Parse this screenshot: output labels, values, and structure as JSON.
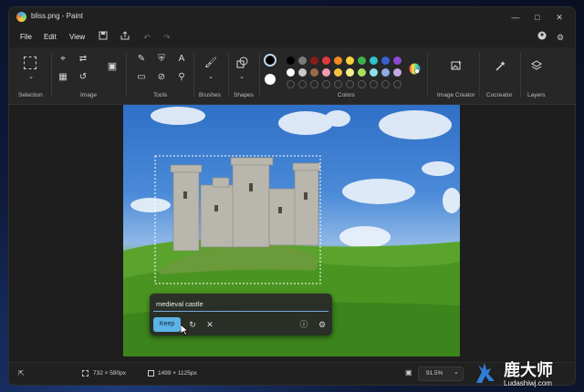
{
  "window": {
    "title": "bliss.png - Paint"
  },
  "menu": {
    "file": "File",
    "edit": "Edit",
    "view": "View"
  },
  "ribbon": {
    "groups": {
      "selection": "Selection",
      "image": "Image",
      "tools": "Tools",
      "brushes": "Brushes",
      "shapes": "Shapes",
      "colors": "Colors",
      "image_creator": "Image Creator",
      "cocreator": "Cocreator",
      "layers": "Layers"
    },
    "palette_row1": [
      "#000000",
      "#7a7a7a",
      "#8a1c1c",
      "#e0393e",
      "#f08a24",
      "#f6d33c",
      "#3bb34a",
      "#2ec4c9",
      "#3a5fd1",
      "#8a4bd1"
    ],
    "palette_row2": [
      "#ffffff",
      "#c8c8c8",
      "#9a6a4a",
      "#f29ab0",
      "#f6c240",
      "#f3ef8a",
      "#a6e05a",
      "#8fe0e6",
      "#8fa9e6",
      "#c4a8e6"
    ],
    "primary_color": "#000000",
    "secondary_color": "#ffffff"
  },
  "image_creator_panel": {
    "prompt_value": "medieval castle",
    "keep_label": "Keep"
  },
  "status": {
    "selection_size": "732 × 580px",
    "image_size": "1499 × 1125px",
    "zoom": "91.5%"
  },
  "watermark": {
    "brand": "鹿大师",
    "url": "Ludashiwj.com"
  }
}
